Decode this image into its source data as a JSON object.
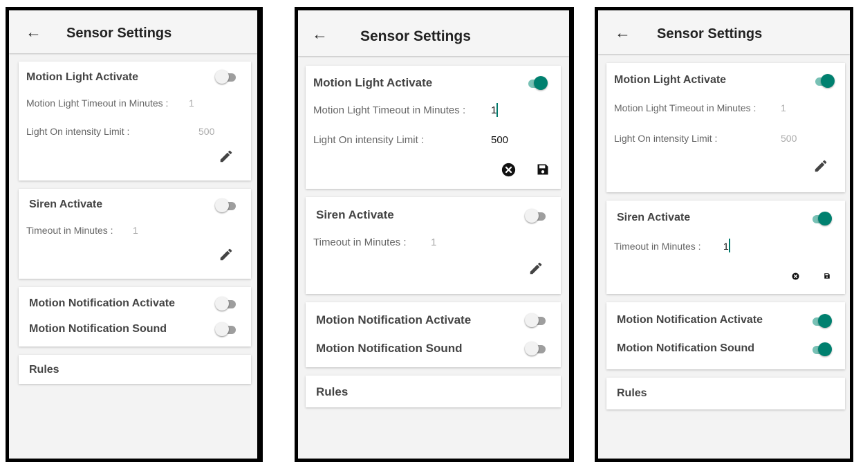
{
  "header": {
    "title": "Sensor Settings"
  },
  "motion_light": {
    "title": "Motion Light Activate",
    "timeout_label": "Motion Light Timeout in Minutes :",
    "timeout_value": "1",
    "intensity_label": "Light On intensity Limit :",
    "intensity_value": "500"
  },
  "siren": {
    "title": "Siren Activate",
    "timeout_label": "Timeout in Minutes :",
    "timeout_value": "1"
  },
  "notification": {
    "activate_label": "Motion Notification Activate",
    "sound_label": "Motion Notification Sound"
  },
  "rules": {
    "label": "Rules"
  },
  "screens": [
    {
      "motion_light_on": false,
      "motion_light_editing": false,
      "siren_on": false,
      "siren_editing": false,
      "notify_on": false,
      "sound_on": false
    },
    {
      "motion_light_on": true,
      "motion_light_editing": true,
      "siren_on": false,
      "siren_editing": false,
      "notify_on": false,
      "sound_on": false
    },
    {
      "motion_light_on": true,
      "motion_light_editing": false,
      "siren_on": true,
      "siren_editing": true,
      "notify_on": true,
      "sound_on": true
    }
  ],
  "colors": {
    "toggle_on": "#00806f",
    "toggle_on_track": "#78c1b5",
    "caret": "#00796b"
  },
  "icons": {
    "back": "arrow-left-icon",
    "edit": "pencil-icon",
    "cancel": "close-circle-icon",
    "save": "floppy-disk-icon"
  }
}
